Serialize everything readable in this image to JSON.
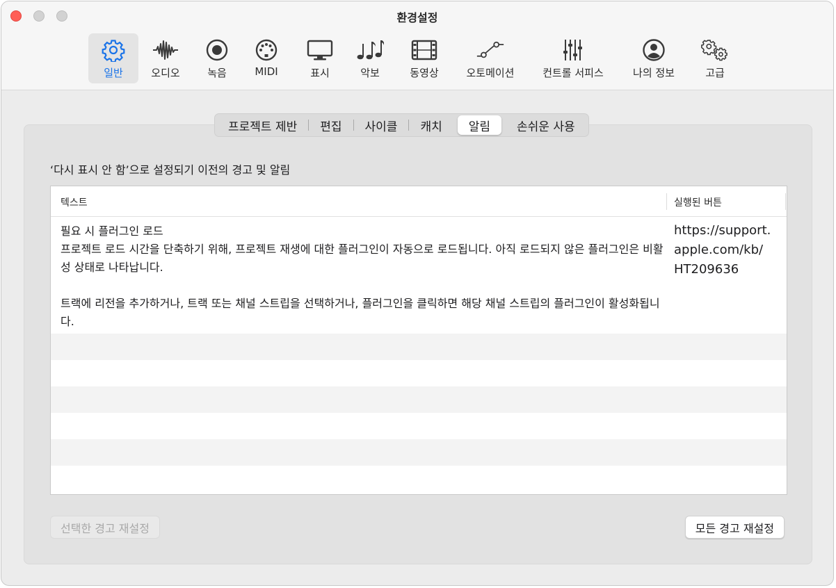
{
  "window": {
    "title": "환경설정"
  },
  "toolbar": {
    "items": [
      {
        "label": "일반",
        "icon": "gear-icon",
        "active": true
      },
      {
        "label": "오디오",
        "icon": "waveform-icon"
      },
      {
        "label": "녹음",
        "icon": "record-icon"
      },
      {
        "label": "MIDI",
        "icon": "midi-port-icon"
      },
      {
        "label": "표시",
        "icon": "display-icon"
      },
      {
        "label": "악보",
        "icon": "music-notes-icon"
      },
      {
        "label": "동영상",
        "icon": "film-icon"
      },
      {
        "label": "오토메이션",
        "icon": "automation-curve-icon"
      },
      {
        "label": "컨트롤 서피스",
        "icon": "sliders-icon"
      },
      {
        "label": "나의 정보",
        "icon": "person-icon"
      },
      {
        "label": "고급",
        "icon": "gears-icon"
      }
    ]
  },
  "tabs": {
    "items": [
      "프로젝트 제반",
      "편집",
      "사이클",
      "캐치",
      "알림",
      "손쉬운 사용"
    ],
    "active": "알림"
  },
  "section": {
    "title": "‘다시 표시 안 함’으로 설정되기 이전의 경고 및 알림"
  },
  "table": {
    "columns": [
      "텍스트",
      "실행된 버튼"
    ],
    "rows": [
      {
        "text_title": "필요 시 플러그인 로드",
        "text_line1": "프로젝트 로드 시간을 단축하기 위해, 프로젝트 재생에 대한 플러그인이 자동으로 로드됩니다. 아직 로드되지 않은 플러그인은 비활성 상태로 나타납니다.",
        "text_line2": "트랙에 리전을 추가하거나, 트랙 또는 채널 스트립을 선택하거나, 플러그인을 클릭하면 해당 채널 스트립의 플러그인이 활성화됩니다.",
        "button": "https://support.apple.com/kb/HT209636"
      }
    ]
  },
  "buttons": {
    "reset_selected": "선택한 경고 재설정",
    "reset_all": "모든 경고 재설정"
  },
  "colors": {
    "accent": "#1a73e8",
    "close": "#ff5f57"
  }
}
